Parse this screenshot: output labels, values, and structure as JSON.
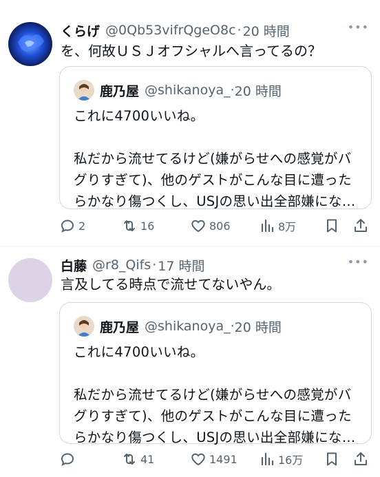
{
  "tweets": [
    {
      "name": "くらげ",
      "handle": "@0Qb53vifrQgeO8c",
      "time": "20 時間",
      "text": "を、何故ＵＳＪオフシャルへ言ってるの？",
      "avatar_color": "#1a3d9e",
      "quote": {
        "name": "鹿乃屋",
        "handle": "@shikanoya_",
        "time": "20 時間",
        "text": "これに4700いいね。\n\n私だから流せてるけど(嫌がらせへの感覚がバグりすぎて)、他のゲストがこんな目に遭ったらかなり傷つくし、USJの思い出全部嫌にな…"
      },
      "stats": {
        "replies": "2",
        "retweets": "16",
        "likes": "806",
        "views": "8万"
      }
    },
    {
      "name": "白藤",
      "handle": "@r8_Qifs",
      "time": "17 時間",
      "text": "言及してる時点で流せてないやん。",
      "avatar_color": "#ddd3e6",
      "quote": {
        "name": "鹿乃屋",
        "handle": "@shikanoya_",
        "time": "20 時間",
        "text": "これに4700いいね。\n\n私だから流せてるけど(嫌がらせへの感覚がバグりすぎて)、他のゲストがこんな目に遭ったらかなり傷つくし、USJの思い出全部嫌にな…"
      },
      "stats": {
        "replies": "",
        "retweets": "41",
        "likes": "1491",
        "views": "16万"
      }
    }
  ],
  "icons": {
    "more": "more-icon",
    "reply": "reply-icon",
    "retweet": "retweet-icon",
    "like": "like-icon",
    "views": "views-icon",
    "bookmark": "bookmark-icon",
    "share": "share-icon"
  },
  "colors": {
    "text": "#0f1419",
    "secondary": "#536471",
    "border": "#cfd9de"
  }
}
